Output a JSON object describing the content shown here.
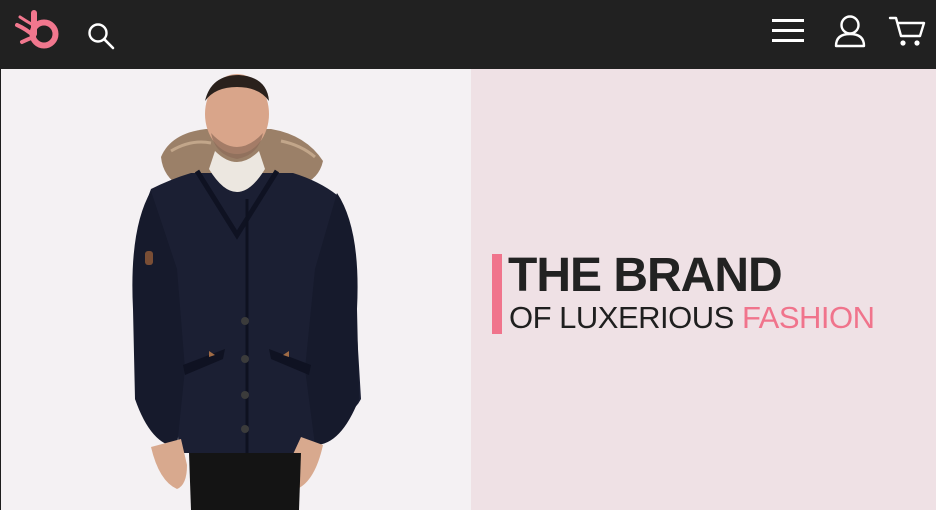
{
  "navbar": {
    "background_color": "#212121",
    "icon_color": "#ffffff",
    "logo": {
      "name": "brand-logo-icon",
      "color": "#f1778e"
    },
    "search_icon": "search-icon",
    "menu_icon": "hamburger-menu-icon",
    "account_icon": "user-icon",
    "cart_icon": "shopping-cart-icon"
  },
  "hero": {
    "image": {
      "description": "model-wearing-navy-parka-with-fur-hood",
      "background_color": "#f4f1f3"
    },
    "panel_background_color": "#efe1e5",
    "accent_color": "#f0748c",
    "headline": "THE BRAND",
    "subline_prefix": "OF LUXERIOUS ",
    "subline_highlight": "FASHION"
  }
}
